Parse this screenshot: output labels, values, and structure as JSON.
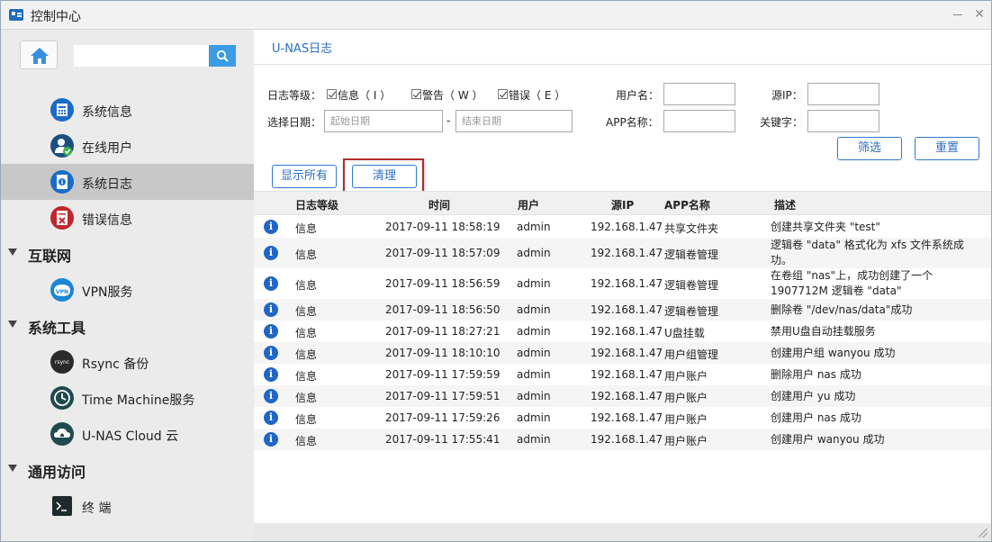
{
  "window": {
    "title": "控制中心"
  },
  "sidebar": {
    "search_placeholder": "",
    "items": [
      {
        "label": "系统信息",
        "icon": "system-info-icon"
      },
      {
        "label": "在线用户",
        "icon": "online-users-icon"
      },
      {
        "label": "系统日志",
        "icon": "system-log-icon",
        "active": true
      },
      {
        "label": "错误信息",
        "icon": "error-info-icon"
      }
    ],
    "groups": [
      {
        "label": "互联网",
        "items": [
          {
            "label": "VPN服务",
            "icon": "vpn-icon"
          }
        ]
      },
      {
        "label": "系统工具",
        "items": [
          {
            "label": "Rsync 备份",
            "icon": "rsync-icon"
          },
          {
            "label": "Time Machine服务",
            "icon": "time-machine-icon"
          },
          {
            "label": "U-NAS Cloud 云",
            "icon": "cloud-icon"
          }
        ]
      },
      {
        "label": "通用访问",
        "items": [
          {
            "label": "终 端",
            "icon": "terminal-icon"
          }
        ]
      }
    ]
  },
  "main": {
    "title": "U-NAS日志",
    "filters": {
      "level_label": "日志等级：",
      "level_info": "信息（ I ）",
      "level_warn": "警告（ W ）",
      "level_error": "错误（ E ）",
      "date_label": "选择日期：",
      "start_placeholder": "起始日期",
      "date_sep": "-",
      "end_placeholder": "结束日期",
      "user_label": "用户名：",
      "user_value": "",
      "app_label": "APP名称：",
      "app_value": "",
      "ip_label": "源IP：",
      "ip_value": "",
      "keyword_label": "关键字：",
      "keyword_value": "",
      "filter_btn": "筛选",
      "reset_btn": "重置",
      "show_all_btn": "显示所有",
      "clear_btn": "清理"
    },
    "table": {
      "headers": [
        "日志等级",
        "时间",
        "用户",
        "源IP",
        "APP名称",
        "描述"
      ],
      "rows": [
        {
          "level": "信息",
          "time": "2017-09-11 18:58:19",
          "user": "admin",
          "ip": "192.168.1.47",
          "app": "共享文件夹",
          "desc": "创建共享文件夹 \"test\""
        },
        {
          "level": "信息",
          "time": "2017-09-11 18:57:09",
          "user": "admin",
          "ip": "192.168.1.47",
          "app": "逻辑卷管理",
          "desc": "逻辑卷 \"data\" 格式化为 xfs 文件系统成功。"
        },
        {
          "level": "信息",
          "time": "2017-09-11 18:56:59",
          "user": "admin",
          "ip": "192.168.1.47",
          "app": "逻辑卷管理",
          "desc": "在卷组 \"nas\"上，成功创建了一个 1907712M 逻辑卷 \"data\""
        },
        {
          "level": "信息",
          "time": "2017-09-11 18:56:50",
          "user": "admin",
          "ip": "192.168.1.47",
          "app": "逻辑卷管理",
          "desc": "删除卷 \"/dev/nas/data\"成功"
        },
        {
          "level": "信息",
          "time": "2017-09-11 18:27:21",
          "user": "admin",
          "ip": "192.168.1.47",
          "app": "U盘挂载",
          "desc": "禁用U盘自动挂载服务"
        },
        {
          "level": "信息",
          "time": "2017-09-11 18:10:10",
          "user": "admin",
          "ip": "192.168.1.47",
          "app": "用户组管理",
          "desc": "创建用户组 wanyou 成功"
        },
        {
          "level": "信息",
          "time": "2017-09-11 17:59:59",
          "user": "admin",
          "ip": "192.168.1.47",
          "app": "用户账户",
          "desc": "删除用户 nas 成功"
        },
        {
          "level": "信息",
          "time": "2017-09-11 17:59:51",
          "user": "admin",
          "ip": "192.168.1.47",
          "app": "用户账户",
          "desc": "创建用户 yu 成功"
        },
        {
          "level": "信息",
          "time": "2017-09-11 17:59:26",
          "user": "admin",
          "ip": "192.168.1.47",
          "app": "用户账户",
          "desc": "创建用户 nas 成功"
        },
        {
          "level": "信息",
          "time": "2017-09-11 17:55:41",
          "user": "admin",
          "ip": "192.168.1.47",
          "app": "用户账户",
          "desc": "创建用户 wanyou 成功"
        }
      ]
    }
  },
  "colors": {
    "accent": "#2f7ad0",
    "info_icon": "#1f66c8",
    "highlight": "#b52a2a"
  }
}
